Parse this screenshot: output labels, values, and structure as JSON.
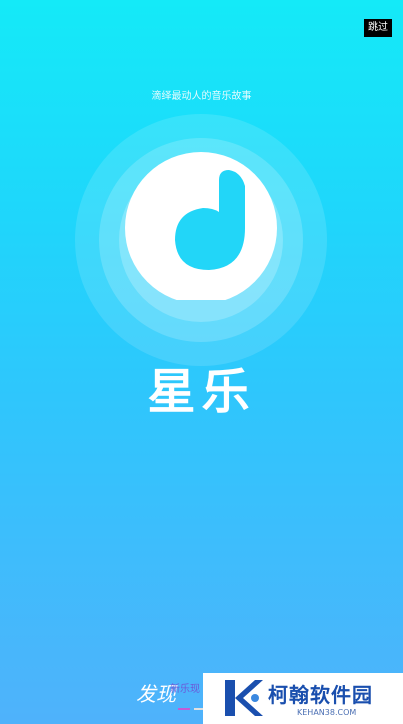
{
  "skip_label": "跳过",
  "tagline": "滴绎最动人的音乐故事",
  "app_name": "星乐",
  "slogan": "发现",
  "sub_note": "新乐现",
  "watermark": {
    "title": "柯翰软件园",
    "url": "KEHAN38.COM"
  },
  "colors": {
    "bg_top": "#14eaf8",
    "bg_bottom": "#4fb2fb",
    "logo_center": "#20d4f7",
    "watermark_blue": "#1a4fae"
  },
  "icons": [
    "music-note-logo-icon",
    "kehan-k-logo-icon"
  ]
}
